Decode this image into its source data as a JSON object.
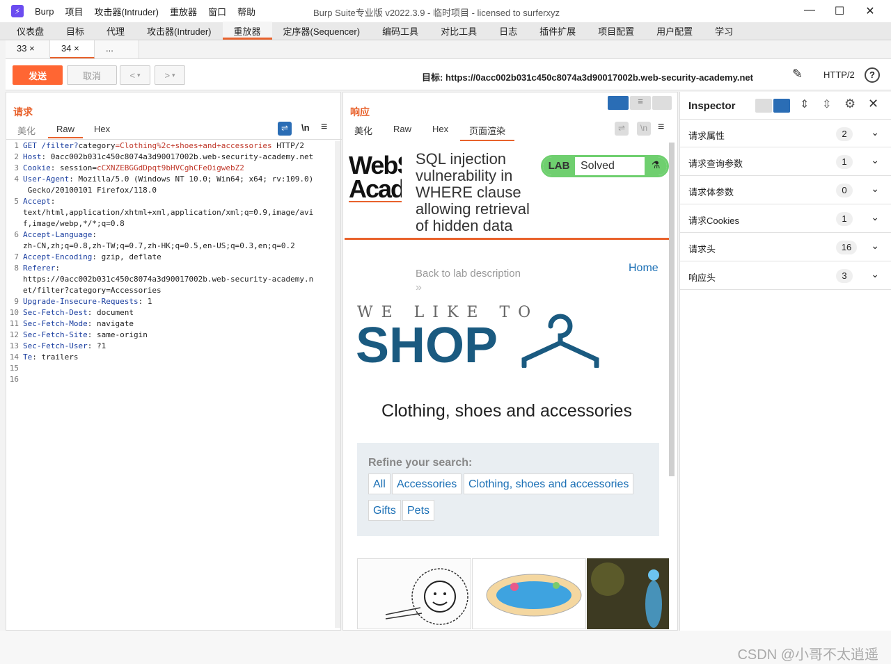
{
  "app": {
    "title": "Burp Suite专业版  v2022.3.9 - 临时项目 - licensed to surferxyz",
    "menu": [
      "Burp",
      "项目",
      "攻击器(Intruder)",
      "重放器",
      "窗口",
      "帮助"
    ]
  },
  "main_tabs": [
    "仪表盘",
    "目标",
    "代理",
    "攻击器(Intruder)",
    "重放器",
    "定序器(Sequencer)",
    "编码工具",
    "对比工具",
    "日志",
    "插件扩展",
    "项目配置",
    "用户配置",
    "学习"
  ],
  "sub_tabs": [
    "33 ×",
    "34 ×",
    "..."
  ],
  "toolbar": {
    "send_label": "发送",
    "cancel_label": "取消",
    "back_label": "<",
    "forward_label": ">",
    "target_text": "目标: https://0acc002b031c450c8074a3d90017002b.web-security-academy.net",
    "protocol": "HTTP/2"
  },
  "request": {
    "title": "请求",
    "tabs": [
      "美化",
      "Raw",
      "Hex"
    ],
    "newline_label": "\\n",
    "lines": [
      {
        "n": "1",
        "k": "GET /filter?",
        "v": "category",
        "r": "=Clothing%2c+shoes+and+accessories",
        "t": " HTTP/2"
      },
      {
        "n": "2",
        "k": "Host",
        "v": ": ",
        "r": "",
        "t": "0acc002b031c450c8074a3d90017002b.web-security-academy.net"
      },
      {
        "n": "3",
        "k": "Cookie",
        "v": ": session=",
        "r": "cCXNZEBGGdDpqt9bHVCghCFeOigwebZ2",
        "t": ""
      },
      {
        "n": "4",
        "k": "User-Agent",
        "v": ": ",
        "r": "",
        "t": "Mozilla/5.0 (Windows NT 10.0; Win64; x64; rv:109.0)"
      },
      {
        "n": "",
        "k": "",
        "v": "",
        "r": "",
        "t": " Gecko/20100101 Firefox/118.0"
      },
      {
        "n": "5",
        "k": "Accept",
        "v": ":",
        "r": "",
        "t": ""
      },
      {
        "n": "",
        "k": "",
        "v": "",
        "r": "",
        "t": "text/html,application/xhtml+xml,application/xml;q=0.9,image/avi"
      },
      {
        "n": "",
        "k": "",
        "v": "",
        "r": "",
        "t": "f,image/webp,*/*;q=0.8"
      },
      {
        "n": "6",
        "k": "Accept-Language",
        "v": ":",
        "r": "",
        "t": ""
      },
      {
        "n": "",
        "k": "",
        "v": "",
        "r": "",
        "t": "zh-CN,zh;q=0.8,zh-TW;q=0.7,zh-HK;q=0.5,en-US;q=0.3,en;q=0.2"
      },
      {
        "n": "7",
        "k": "Accept-Encoding",
        "v": ": ",
        "r": "",
        "t": "gzip, deflate"
      },
      {
        "n": "8",
        "k": "Referer",
        "v": ":",
        "r": "",
        "t": ""
      },
      {
        "n": "",
        "k": "",
        "v": "",
        "r": "",
        "t": "https://0acc002b031c450c8074a3d90017002b.web-security-academy.n"
      },
      {
        "n": "",
        "k": "",
        "v": "",
        "r": "",
        "t": "et/filter?category=Accessories"
      },
      {
        "n": "9",
        "k": "Upgrade-Insecure-Requests",
        "v": ": ",
        "r": "",
        "t": "1"
      },
      {
        "n": "10",
        "k": "Sec-Fetch-Dest",
        "v": ": ",
        "r": "",
        "t": "document"
      },
      {
        "n": "11",
        "k": "Sec-Fetch-Mode",
        "v": ": ",
        "r": "",
        "t": "navigate"
      },
      {
        "n": "12",
        "k": "Sec-Fetch-Site",
        "v": ": ",
        "r": "",
        "t": "same-origin"
      },
      {
        "n": "13",
        "k": "Sec-Fetch-User",
        "v": ": ",
        "r": "",
        "t": "?1"
      },
      {
        "n": "14",
        "k": "Te",
        "v": ": ",
        "r": "",
        "t": "trailers"
      },
      {
        "n": "15",
        "k": "",
        "v": "",
        "r": "",
        "t": ""
      },
      {
        "n": "16",
        "k": "",
        "v": "",
        "r": "",
        "t": ""
      }
    ]
  },
  "response": {
    "title": "响应",
    "tabs": [
      "美化",
      "Raw",
      "Hex",
      "页面渲染"
    ],
    "newline_label": "\\n",
    "render": {
      "logo_line1": "WebS",
      "logo_line2": "Acad",
      "lab_title": "SQL injection vulnerability in WHERE clause allowing retrieval of hidden data",
      "lab_badge": "LAB",
      "lab_status": "Solved",
      "back_link": "Back to lab description",
      "home_link": "Home",
      "we_like_to": "WE LIKE TO",
      "shop": "SHOP",
      "category_heading": "Clothing, shoes and accessories",
      "refine_label": "Refine your search:",
      "filters": [
        "All",
        "Accessories",
        "Clothing, shoes and accessories",
        "Gifts",
        "Pets"
      ]
    }
  },
  "inspector": {
    "title": "Inspector",
    "rows": [
      {
        "label": "请求属性",
        "count": "2"
      },
      {
        "label": "请求查询参数",
        "count": "1"
      },
      {
        "label": "请求体参数",
        "count": "0"
      },
      {
        "label": "请求Cookies",
        "count": "1"
      },
      {
        "label": "请求头",
        "count": "16"
      },
      {
        "label": "响应头",
        "count": "3"
      }
    ]
  },
  "footer": {
    "watermark": "CSDN @小哥不太逍遥"
  },
  "colors": {
    "accent": "#e8622c",
    "send": "#ff6633",
    "shop_blue": "#1a5a80",
    "link_blue": "#1a6fb5",
    "lab_green": "#6fcf6f"
  }
}
